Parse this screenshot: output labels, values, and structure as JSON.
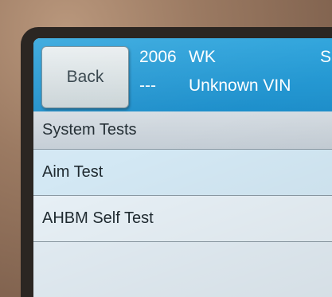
{
  "header": {
    "back_label": "Back",
    "year": "2006",
    "model": "WK",
    "extra": "S",
    "dashes": "---",
    "vin": "Unknown VIN"
  },
  "menu": {
    "title": "System Tests",
    "items": [
      {
        "label": "Aim Test"
      },
      {
        "label": "AHBM Self Test"
      }
    ]
  },
  "colors": {
    "header_blue": "#1e8fcb",
    "selected_row": "#d3e8f4",
    "screen_bg": "#eef3f7"
  }
}
